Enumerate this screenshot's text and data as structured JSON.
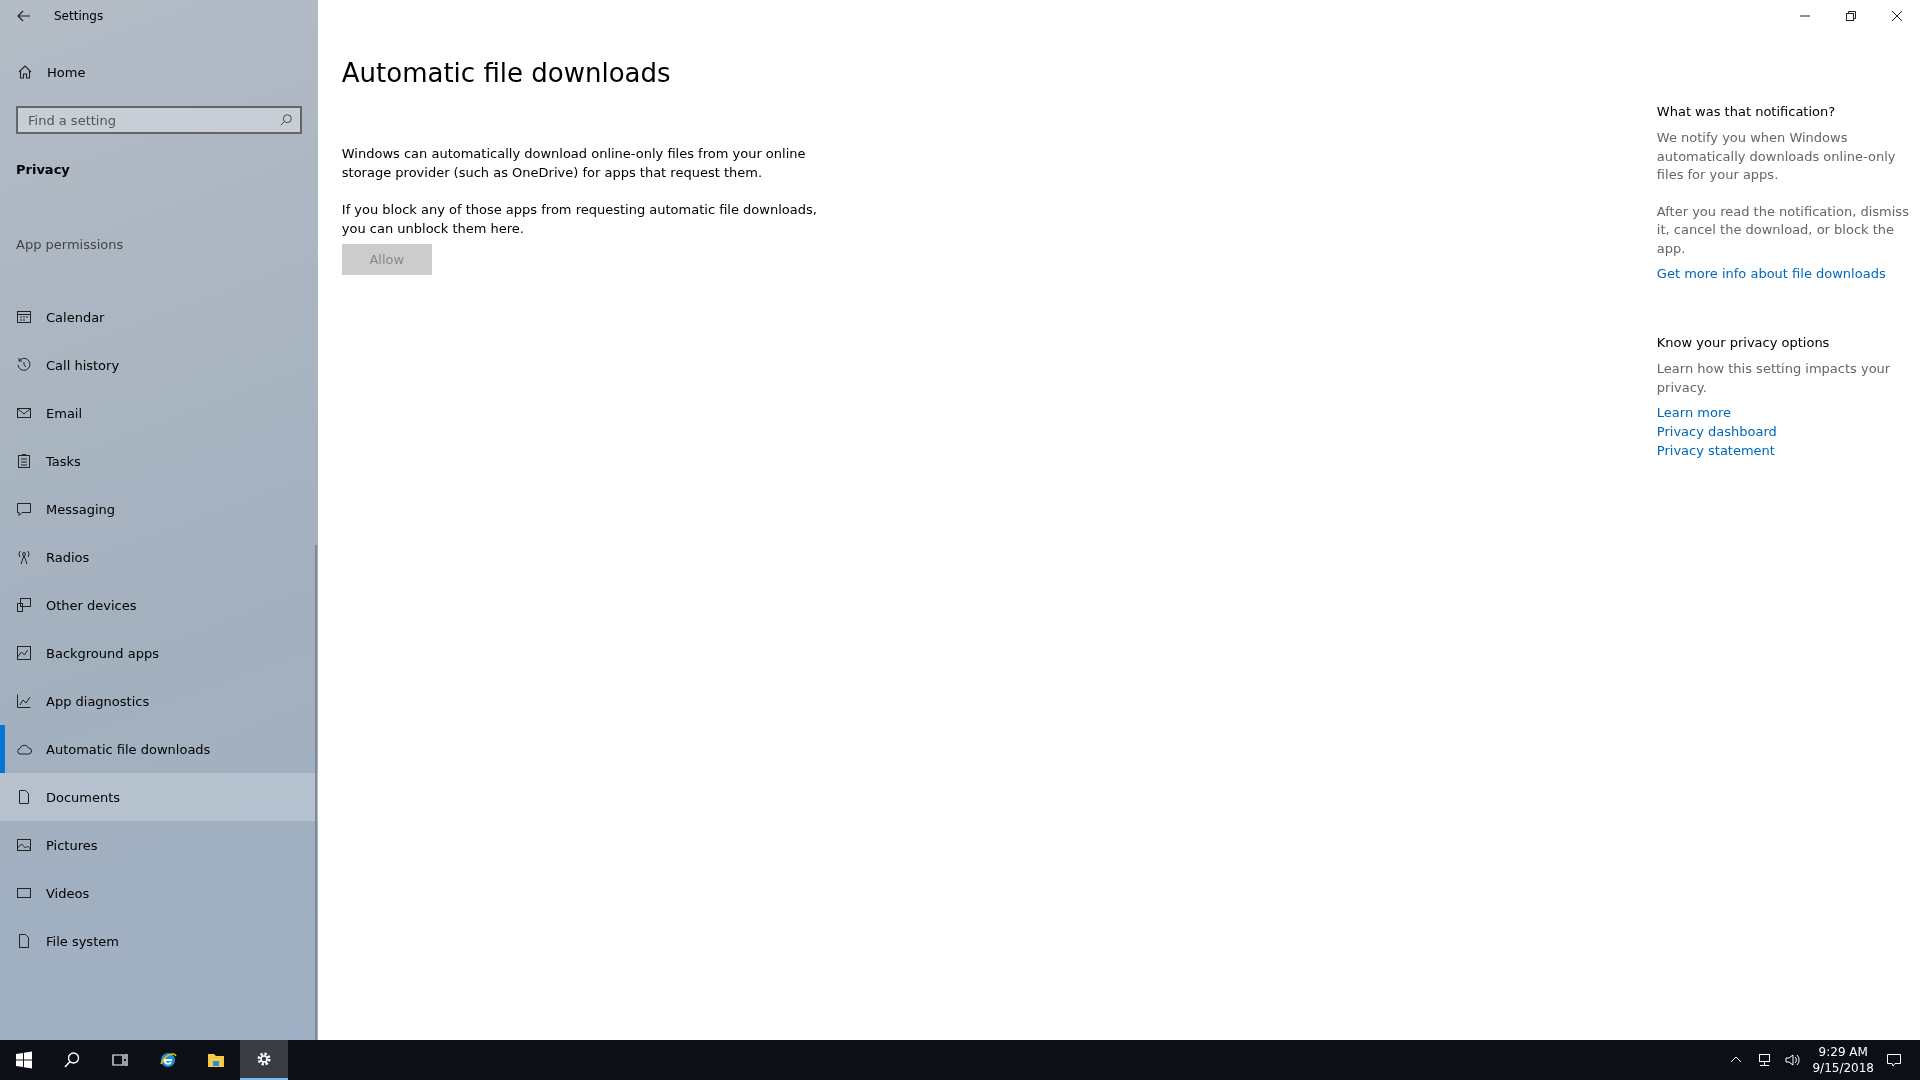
{
  "window": {
    "title": "Settings"
  },
  "sidebar": {
    "home": "Home",
    "search": {
      "placeholder": "Find a setting"
    },
    "section": "Privacy",
    "group": "App permissions",
    "items": [
      {
        "label": "Calendar",
        "selected": false,
        "hovered": false
      },
      {
        "label": "Call history",
        "selected": false,
        "hovered": false
      },
      {
        "label": "Email",
        "selected": false,
        "hovered": false
      },
      {
        "label": "Tasks",
        "selected": false,
        "hovered": false
      },
      {
        "label": "Messaging",
        "selected": false,
        "hovered": false
      },
      {
        "label": "Radios",
        "selected": false,
        "hovered": false
      },
      {
        "label": "Other devices",
        "selected": false,
        "hovered": false
      },
      {
        "label": "Background apps",
        "selected": false,
        "hovered": false
      },
      {
        "label": "App diagnostics",
        "selected": false,
        "hovered": false
      },
      {
        "label": "Automatic file downloads",
        "selected": true,
        "hovered": false
      },
      {
        "label": "Documents",
        "selected": false,
        "hovered": true
      },
      {
        "label": "Pictures",
        "selected": false,
        "hovered": false
      },
      {
        "label": "Videos",
        "selected": false,
        "hovered": false
      },
      {
        "label": "File system",
        "selected": false,
        "hovered": false
      }
    ]
  },
  "main": {
    "title": "Automatic file downloads",
    "paragraphs": [
      "Windows can automatically download online-only files from your online storage provider (such as OneDrive) for apps that request them.",
      "If you block any of those apps from requesting automatic file downloads, you can unblock them here."
    ],
    "button": {
      "label": "Allow",
      "disabled": true
    }
  },
  "aside": [
    {
      "heading": "What was that notification?",
      "paragraphs": [
        "We notify you when Windows automatically downloads online-only files for your apps.",
        "After you read the notification, dismiss it, cancel the download, or block the app."
      ],
      "links": [
        "Get more info about file downloads"
      ]
    },
    {
      "heading": "Know your privacy options",
      "paragraphs": [
        "Learn how this setting impacts your privacy."
      ],
      "links": [
        "Learn more",
        "Privacy dashboard",
        "Privacy statement"
      ]
    }
  ],
  "taskbar": {
    "apps": [
      {
        "selected": false
      },
      {
        "selected": false
      },
      {
        "selected": false
      },
      {
        "selected": false
      },
      {
        "selected": false
      },
      {
        "selected": true
      }
    ],
    "time": "9:29 AM",
    "date": "9/15/2018"
  }
}
